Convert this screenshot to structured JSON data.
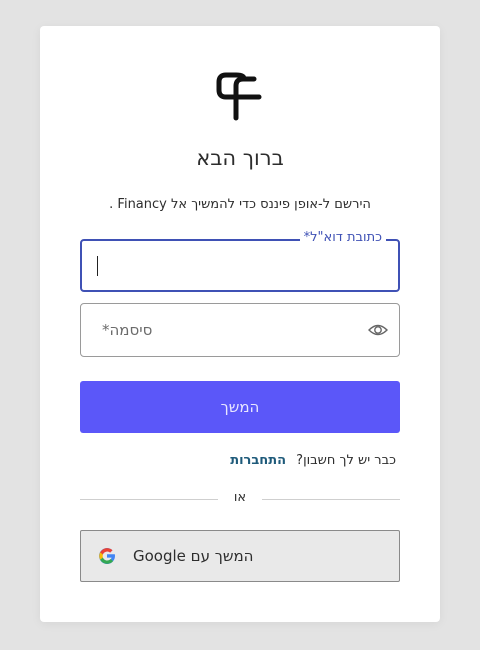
{
  "header": {
    "title": "ברוך הבא",
    "subtitle": "הירשם ל-אופן פיננס כדי להמשיך אל Financy ."
  },
  "form": {
    "email": {
      "label": "כתובת דוא\"ל*",
      "value": ""
    },
    "password": {
      "placeholder": "סיסמה*",
      "value": ""
    },
    "continue_label": "המשך"
  },
  "login": {
    "prompt": "כבר יש לך חשבון?",
    "link_label": "התחברות"
  },
  "divider": {
    "label": "או"
  },
  "social": {
    "google_label": "המשך עם Google"
  },
  "icons": {
    "logo": "app-logo-icon",
    "password_toggle": "eye-icon",
    "google": "google-icon"
  },
  "colors": {
    "primary": "#5b57f9",
    "focus_border": "#3f51b5",
    "link": "#1e5a7a",
    "page_background": "#e3e3e3"
  }
}
